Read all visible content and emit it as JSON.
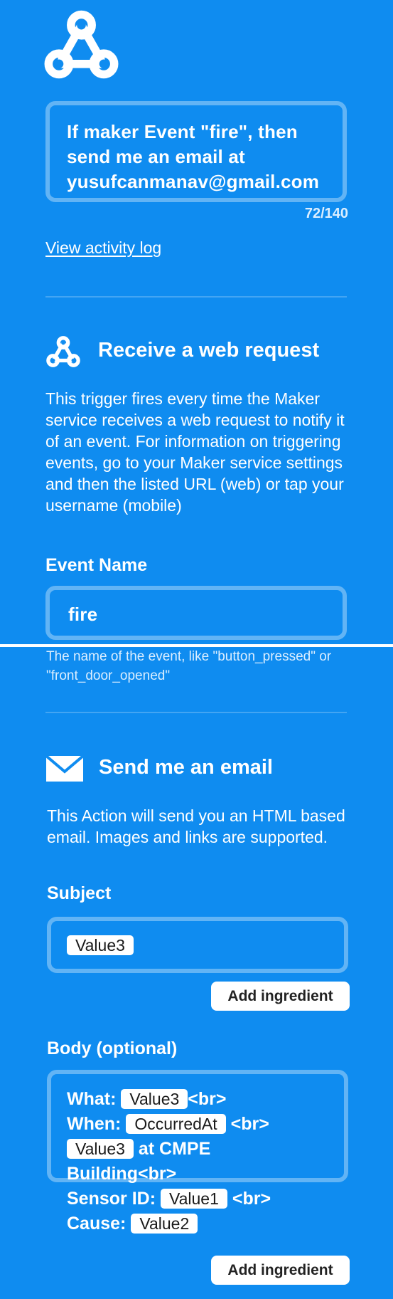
{
  "applet": {
    "icon": "webhooks-icon",
    "title_text": "If maker Event \"fire\", then send me an email at yusufcanmanav@gmail.com",
    "char_count": "72/140",
    "activity_link": "View activity log"
  },
  "trigger": {
    "icon": "webhooks-icon",
    "title": "Receive a web request",
    "description": "This trigger fires every time the Maker service receives a web request to notify it of an event. For information on triggering events, go to your Maker service settings and then the listed URL (web) or tap your username (mobile)",
    "field_label": "Event Name",
    "field_value": "fire",
    "field_help": "The name of the event, like \"button_pressed\" or \"front_door_opened\""
  },
  "action": {
    "icon": "envelope-icon",
    "title": "Send me an email",
    "description": "This Action will send you an HTML based email. Images and links are supported.",
    "subject_label": "Subject",
    "subject_ingredient": "Value3",
    "add_ingredient_label": "Add ingredient",
    "body_label": "Body (optional)",
    "body": {
      "what_label": "What:",
      "what_value": "Value3",
      "when_label": "When:",
      "when_value": "OccurredAt",
      "br": "<br>",
      "location_value": "Value3",
      "location_text": "at CMPE",
      "location_text2": "Building<br>",
      "sensor_label": "Sensor ID:",
      "sensor_value": "Value1",
      "cause_label": "Cause:",
      "cause_value": "Value2"
    }
  },
  "colors": {
    "background": "#0f8cf0",
    "text": "#ffffff",
    "pill_background": "#ffffff"
  }
}
